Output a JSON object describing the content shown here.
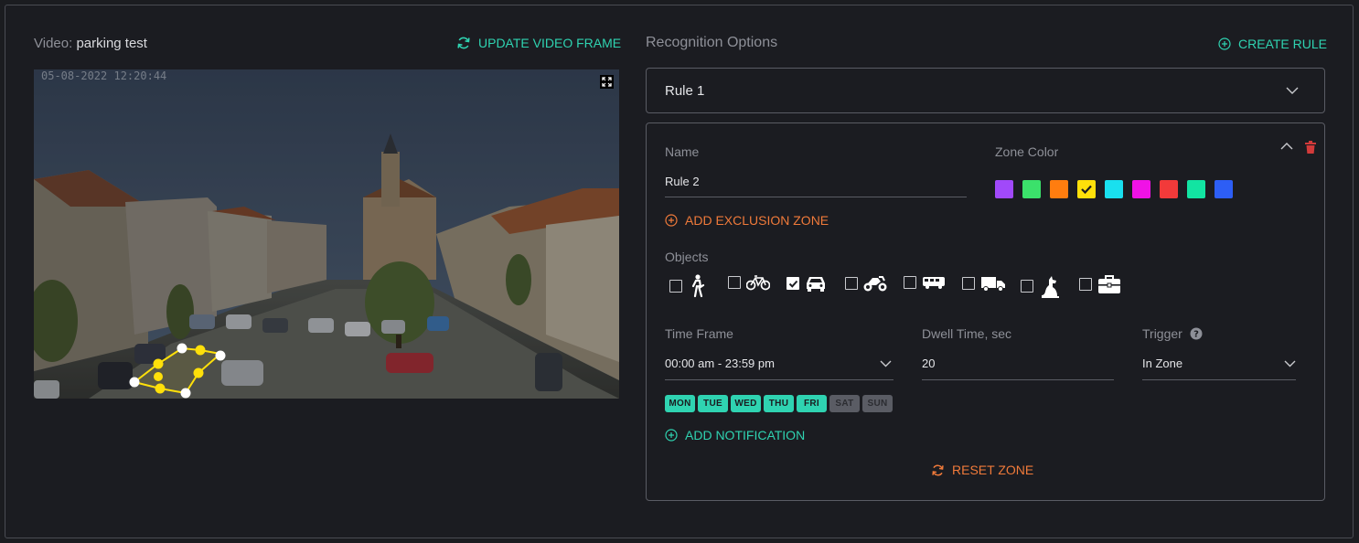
{
  "video": {
    "label": "Video:",
    "name": "parking test",
    "update_label": "UPDATE VIDEO FRAME",
    "timestamp": "05-08-2022 12:20:44"
  },
  "recognition": {
    "title": "Recognition Options",
    "create_rule_label": "CREATE RULE"
  },
  "rule1": {
    "title": "Rule 1"
  },
  "rule2": {
    "name_label": "Name",
    "name_value": "Rule 2",
    "zone_color_label": "Zone Color",
    "zone_colors": [
      "#a149fa",
      "#3be16b",
      "#ff7d0f",
      "#ffe00a",
      "#19e0ef",
      "#f012e6",
      "#f23a3a",
      "#12e4a2",
      "#2d5ef5"
    ],
    "selected_color": "#ffe00a",
    "add_exclusion_label": "ADD EXCLUSION ZONE",
    "objects_label": "Objects",
    "objects": [
      {
        "icon": "person-icon",
        "checked": false
      },
      {
        "icon": "bicycle-icon",
        "checked": false
      },
      {
        "icon": "car-icon",
        "checked": true
      },
      {
        "icon": "motorcycle-icon",
        "checked": false
      },
      {
        "icon": "bus-icon",
        "checked": false
      },
      {
        "icon": "truck-icon",
        "checked": false
      },
      {
        "icon": "dog-icon",
        "checked": false
      },
      {
        "icon": "briefcase-icon",
        "checked": false
      }
    ],
    "time_frame_label": "Time Frame",
    "time_frame_value": "00:00 am - 23:59 pm",
    "dwell_label": "Dwell Time, sec",
    "dwell_value": "20",
    "trigger_label": "Trigger",
    "trigger_value": "In Zone",
    "days": [
      {
        "label": "MON",
        "active": true
      },
      {
        "label": "TUE",
        "active": true
      },
      {
        "label": "WED",
        "active": true
      },
      {
        "label": "THU",
        "active": true
      },
      {
        "label": "FRI",
        "active": true
      },
      {
        "label": "SAT",
        "active": false
      },
      {
        "label": "SUN",
        "active": false
      }
    ],
    "add_notification_label": "ADD NOTIFICATION",
    "reset_zone_label": "RESET ZONE"
  },
  "colors": {
    "accent_teal": "#2fd3b1",
    "accent_orange": "#f07a3a",
    "delete_red": "#d23a3a",
    "zone_polygon": "#ffe00a"
  }
}
